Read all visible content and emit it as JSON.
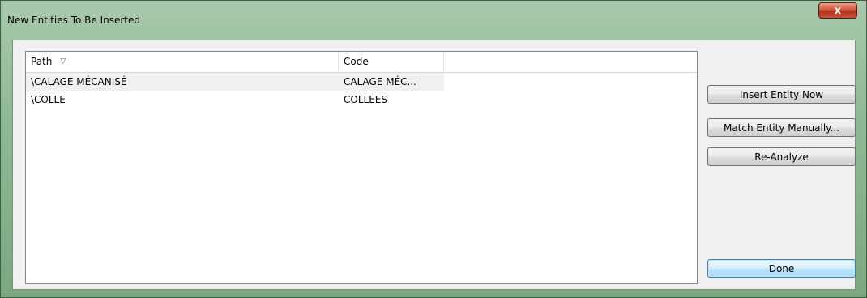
{
  "window": {
    "title": "New Entities To Be Inserted",
    "close_label": "x"
  },
  "list": {
    "columns": [
      {
        "label": "Path",
        "sorted": true
      },
      {
        "label": "Code"
      }
    ],
    "rows": [
      {
        "path": "\\CALAGE MÉCANISÉ",
        "code": "CALAGE MÉC...",
        "selected": true
      },
      {
        "path": "\\COLLE",
        "code": "COLLEES",
        "selected": false
      }
    ]
  },
  "buttons": {
    "insert": "Insert Entity Now",
    "match": "Match Entity Manually...",
    "reanalyze": "Re-Analyze",
    "done": "Done"
  },
  "icons": {
    "sort": "sort-indicator-icon",
    "close": "close-icon"
  },
  "colors": {
    "selected_row": "#f0f0f0",
    "primary_button_border": "#3c7fb1",
    "close_button": "#c8553b"
  }
}
